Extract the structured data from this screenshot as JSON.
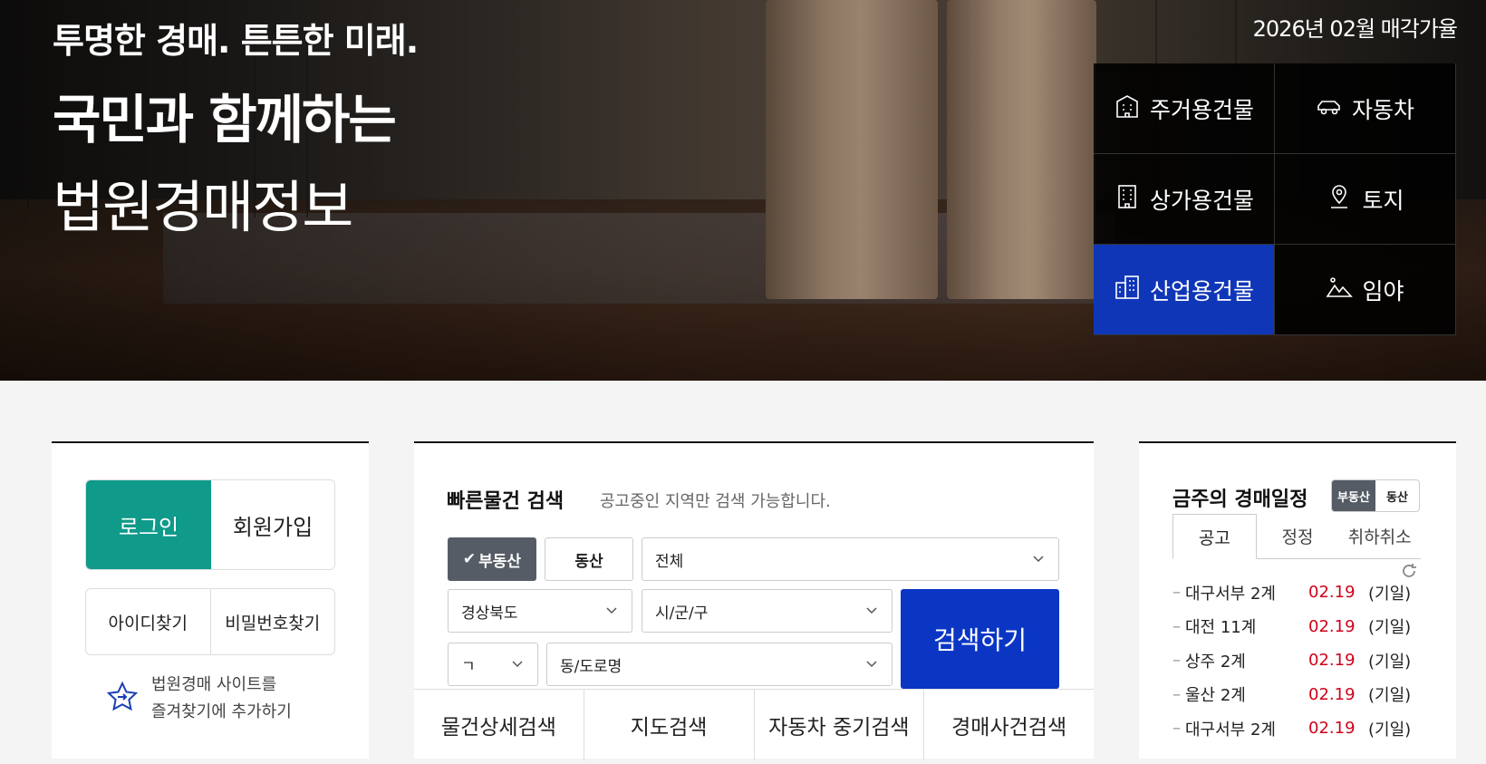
{
  "hero": {
    "slogan": "투명한 경매. 튼튼한 미래.",
    "headline1": "국민과 함께하는",
    "headline2": "법원경매정보",
    "sale_rate": "2026년 02월 매각가율"
  },
  "categories": [
    {
      "label": "주거용건물",
      "icon": "house-building-icon",
      "active": false
    },
    {
      "label": "자동차",
      "icon": "car-icon",
      "active": false
    },
    {
      "label": "상가용건물",
      "icon": "commercial-building-icon",
      "active": false
    },
    {
      "label": "토지",
      "icon": "map-pin-icon",
      "active": false
    },
    {
      "label": "산업용건물",
      "icon": "industrial-building-icon",
      "active": true
    },
    {
      "label": "임야",
      "icon": "mountain-icon",
      "active": false
    }
  ],
  "login": {
    "login_label": "로그인",
    "join_label": "회원가입",
    "find_id_label": "아이디찾기",
    "find_pw_label": "비밀번호찾기",
    "fav_line1": "법원경매 사이트를",
    "fav_line2": "즐겨찾기에 추가하기"
  },
  "search": {
    "title": "빠른물건 검색",
    "note": "공고중인 지역만 검색 가능합니다.",
    "toggle_real_estate": "부동산",
    "toggle_movable": "동산",
    "type_select": "전체",
    "province_select": "경상북도",
    "city_select": "시/군/구",
    "initial_select": "ㄱ",
    "road_select": "동/도로명",
    "search_button": "검색하기",
    "tabs": [
      "물건상세검색",
      "지도검색",
      "자동차 중기검색",
      "경매사건검색"
    ]
  },
  "schedule": {
    "title": "금주의 경매일정",
    "toggle_real_estate": "부동산",
    "toggle_movable": "동산",
    "tabs": [
      "공고",
      "정정",
      "취하취소"
    ],
    "items": [
      {
        "court": "대구서부 2계",
        "date": "02.19",
        "type": "(기일)"
      },
      {
        "court": "대전 11계",
        "date": "02.19",
        "type": "(기일)"
      },
      {
        "court": "상주 2계",
        "date": "02.19",
        "type": "(기일)"
      },
      {
        "court": "울산 2계",
        "date": "02.19",
        "type": "(기일)"
      },
      {
        "court": "대구서부 2계",
        "date": "02.19",
        "type": "(기일)"
      }
    ]
  },
  "colors": {
    "accent_blue": "#0b36c4",
    "login_teal": "#0f9a8a",
    "date_red": "#d0021b"
  }
}
